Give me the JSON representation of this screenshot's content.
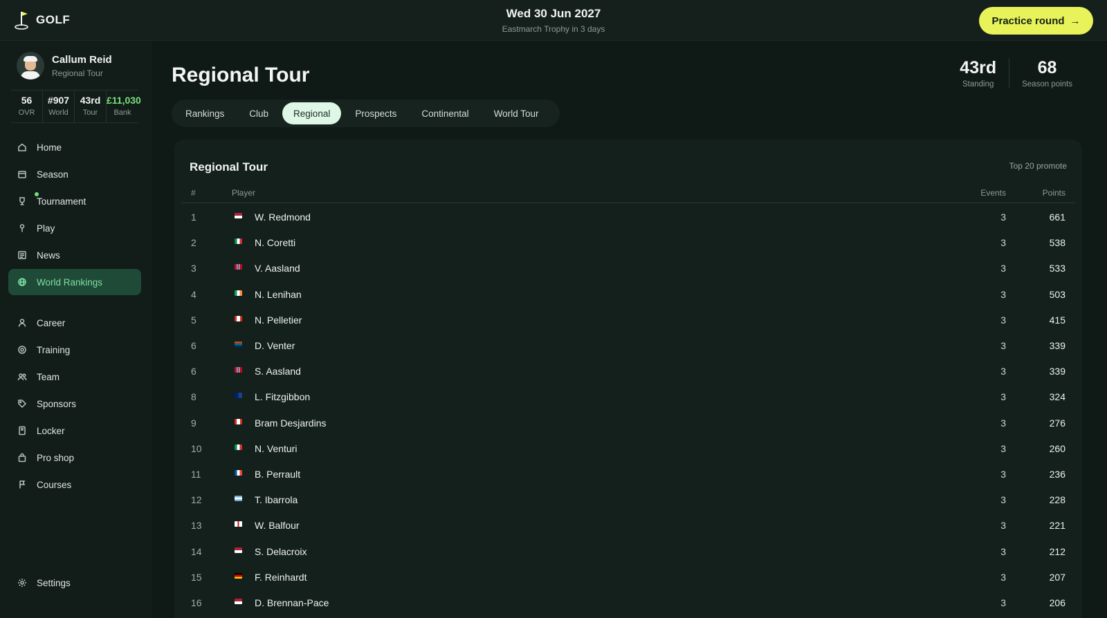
{
  "header": {
    "logo_text": "GOLF",
    "date": "Wed 30 Jun 2027",
    "subtitle": "Eastmarch Trophy in 3 days",
    "practice_label": "Practice round",
    "accent": "#e8f35a"
  },
  "profile": {
    "name": "Callum Reid",
    "tour": "Regional Tour",
    "stats": [
      {
        "value": "56",
        "label": "OVR"
      },
      {
        "value": "#907",
        "label": "World"
      },
      {
        "value": "43rd",
        "label": "Tour"
      },
      {
        "value": "£11,030",
        "label": "Bank"
      }
    ]
  },
  "nav": {
    "items": [
      {
        "label": "Home",
        "icon": "home-icon"
      },
      {
        "label": "Season",
        "icon": "calendar-icon"
      },
      {
        "label": "Tournament",
        "icon": "trophy-icon"
      },
      {
        "label": "Play",
        "icon": "golf-tee-icon"
      },
      {
        "label": "News",
        "icon": "newspaper-icon"
      },
      {
        "label": "World Rankings",
        "icon": "globe-icon",
        "active": true
      },
      {
        "label": "Career",
        "icon": "person-icon"
      },
      {
        "label": "Training",
        "icon": "target-icon"
      },
      {
        "label": "Team",
        "icon": "team-icon"
      },
      {
        "label": "Sponsors",
        "icon": "tag-icon"
      },
      {
        "label": "Locker",
        "icon": "locker-icon"
      },
      {
        "label": "Pro shop",
        "icon": "shopping-bag-icon"
      },
      {
        "label": "Courses",
        "icon": "flag-icon"
      },
      {
        "label": "Settings",
        "icon": "gear-icon"
      }
    ]
  },
  "main": {
    "title": "Regional Tour",
    "standing": {
      "value": "43rd",
      "label": "Standing"
    },
    "season_points": {
      "value": "68",
      "label": "Season points"
    },
    "tabs": [
      {
        "label": "Rankings"
      },
      {
        "label": "Club"
      },
      {
        "label": "Regional",
        "active": true
      },
      {
        "label": "Prospects"
      },
      {
        "label": "Continental"
      },
      {
        "label": "World Tour"
      }
    ],
    "table": {
      "title": "Regional Tour",
      "note": "Top 20 promote",
      "columns": {
        "rank": "#",
        "player": "Player",
        "events": "Events",
        "points": "Points"
      },
      "rows": [
        {
          "rank": "1",
          "flag": "us",
          "name": "W. Redmond",
          "events": "3",
          "points": "661"
        },
        {
          "rank": "2",
          "flag": "it",
          "name": "N. Coretti",
          "events": "3",
          "points": "538"
        },
        {
          "rank": "3",
          "flag": "no",
          "name": "V. Aasland",
          "events": "3",
          "points": "533"
        },
        {
          "rank": "4",
          "flag": "ie",
          "name": "N. Lenihan",
          "events": "3",
          "points": "503"
        },
        {
          "rank": "5",
          "flag": "ca",
          "name": "N. Pelletier",
          "events": "3",
          "points": "415"
        },
        {
          "rank": "6",
          "flag": "za",
          "name": "D. Venter",
          "events": "3",
          "points": "339"
        },
        {
          "rank": "6",
          "flag": "no",
          "name": "S. Aasland",
          "events": "3",
          "points": "339"
        },
        {
          "rank": "8",
          "flag": "au",
          "name": "L. Fitzgibbon",
          "events": "3",
          "points": "324"
        },
        {
          "rank": "9",
          "flag": "ca",
          "name": "Bram Desjardins",
          "events": "3",
          "points": "276"
        },
        {
          "rank": "10",
          "flag": "it",
          "name": "N. Venturi",
          "events": "3",
          "points": "260"
        },
        {
          "rank": "11",
          "flag": "fr",
          "name": "B. Perrault",
          "events": "3",
          "points": "236"
        },
        {
          "rank": "12",
          "flag": "ar",
          "name": "T. Ibarrola",
          "events": "3",
          "points": "228"
        },
        {
          "rank": "13",
          "flag": "en",
          "name": "W. Balfour",
          "events": "3",
          "points": "221"
        },
        {
          "rank": "14",
          "flag": "us",
          "name": "S. Delacroix",
          "events": "3",
          "points": "212"
        },
        {
          "rank": "15",
          "flag": "de",
          "name": "F. Reinhardt",
          "events": "3",
          "points": "207"
        },
        {
          "rank": "16",
          "flag": "us",
          "name": "D. Brennan-Pace",
          "events": "3",
          "points": "206"
        }
      ]
    }
  }
}
